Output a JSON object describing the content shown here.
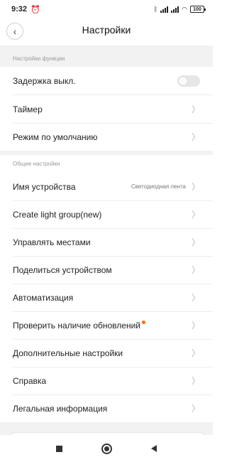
{
  "status_bar": {
    "time": "9:32",
    "alarm_icon": "alarm-clock-icon",
    "battery": "100"
  },
  "header": {
    "title": "Настройки",
    "back_icon": "back-arrow-icon"
  },
  "sections": [
    {
      "label": "Настройки функции",
      "items": [
        {
          "label": "Задержка выкл.",
          "control": "toggle",
          "toggle_on": false
        },
        {
          "label": "Таймер"
        },
        {
          "label": "Режим по умолчанию"
        }
      ]
    },
    {
      "label": "Общие настройки",
      "items": [
        {
          "label": "Имя устройства",
          "value": "Светодиодная лента"
        },
        {
          "label": "Create light group(new)"
        },
        {
          "label": "Управлять местами"
        },
        {
          "label": "Поделиться устройством"
        },
        {
          "label": "Автоматизация"
        },
        {
          "label": "Проверить наличие обновлений",
          "badge": "update-dot"
        },
        {
          "label": "Дополнительные настройки"
        },
        {
          "label": "Справка"
        },
        {
          "label": "Легальная информация"
        }
      ]
    }
  ],
  "colors": {
    "accent_dot": "#ff6a13",
    "section_bg": "#f2f2f2",
    "toggle_off": "#e6e6e6"
  },
  "nav_bar": {
    "recents_icon": "square-recents-icon",
    "home_icon": "circle-home-icon",
    "back_icon": "triangle-back-icon"
  }
}
